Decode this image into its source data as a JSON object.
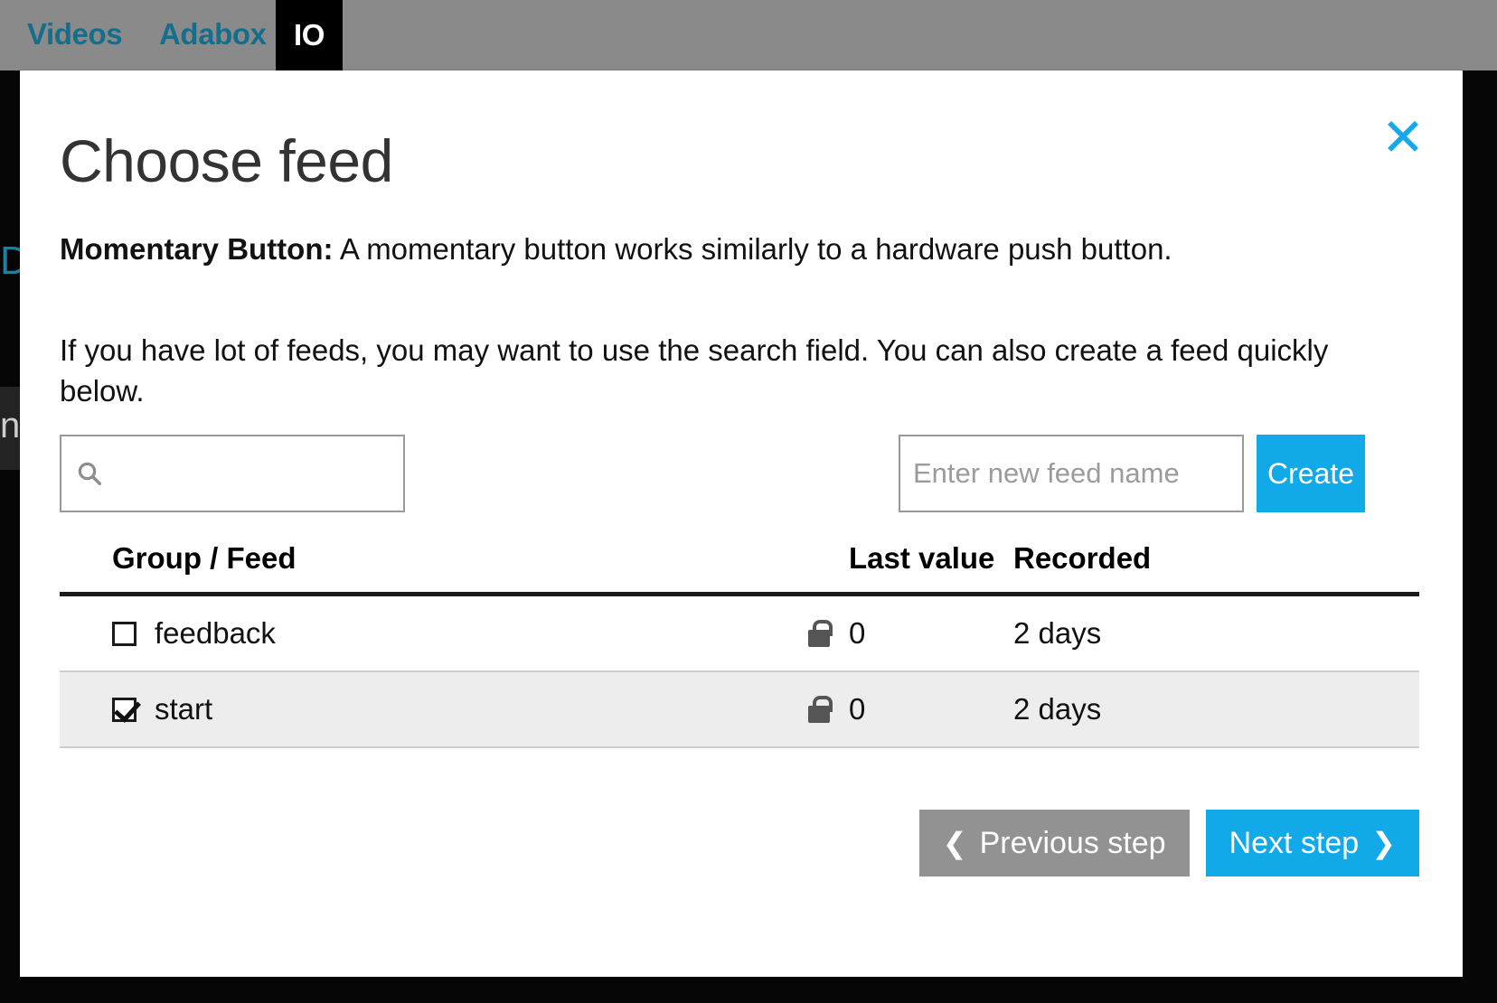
{
  "background": {
    "navbar": {
      "items": [
        {
          "label": "Videos",
          "active": false
        },
        {
          "label": "Adabox",
          "active": false
        },
        {
          "label": "IO",
          "active": true
        }
      ]
    },
    "page_heading_fragment": "Da",
    "sub_bar_fragment": "ne"
  },
  "modal": {
    "title": "Choose feed",
    "close_label": "✕",
    "description_strong": "Momentary Button:",
    "description_rest": " A momentary button works similarly to a hardware push button.",
    "hint": "If you have lot of feeds, you may want to use the search field. You can also create a feed quickly below.",
    "search": {
      "value": "",
      "placeholder": "",
      "icon": "search-icon"
    },
    "create": {
      "input_value": "",
      "input_placeholder": "Enter new feed name",
      "button_label": "Create"
    },
    "table": {
      "columns": [
        "Group / Feed",
        "Last value",
        "Recorded"
      ],
      "rows": [
        {
          "name": "feedback",
          "checked": false,
          "selected": false,
          "locked": true,
          "last_value": "0",
          "recorded": "2 days"
        },
        {
          "name": "start",
          "checked": true,
          "selected": true,
          "locked": true,
          "last_value": "0",
          "recorded": "2 days"
        }
      ]
    },
    "footer": {
      "previous_label": "Previous step",
      "previous_chevron": "❮",
      "next_label": "Next step",
      "next_chevron": "❯"
    }
  },
  "colors": {
    "accent_blue": "#12a9e8",
    "nav_link_blue": "#146e8e",
    "muted_gray": "#929292",
    "navbar_gray": "#8a8a8a",
    "row_selected": "#ededed"
  }
}
